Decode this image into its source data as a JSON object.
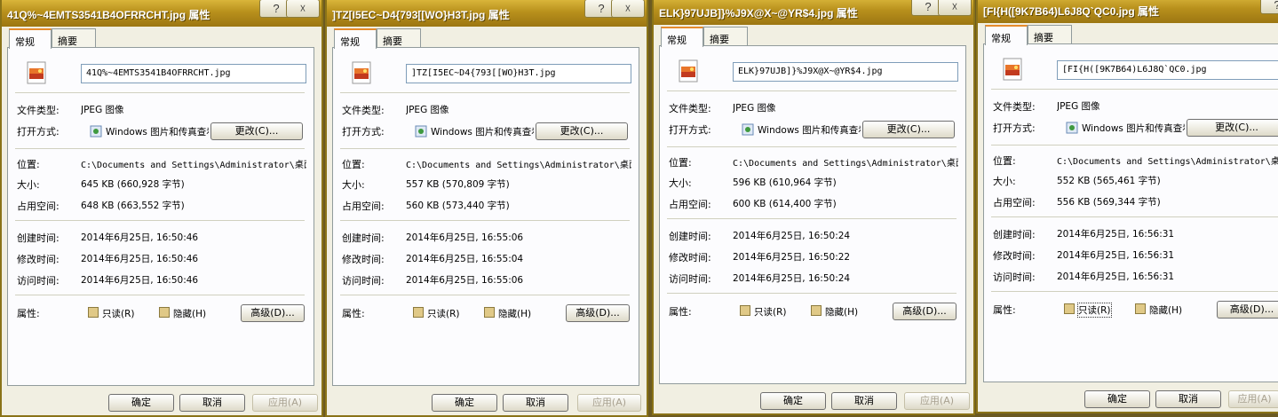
{
  "titlebar_buttons": {
    "help": "?",
    "close": "☓"
  },
  "tabs": {
    "general": "常规",
    "summary": "摘要"
  },
  "labels": {
    "type": "文件类型:",
    "opens_with": "打开方式:",
    "location": "位置:",
    "size": "大小:",
    "size_on_disk": "占用空间:",
    "created": "创建时间:",
    "modified": "修改时间:",
    "accessed": "访问时间:",
    "attributes": "属性:"
  },
  "buttons": {
    "change": "更改(C)...",
    "advanced": "高级(D)...",
    "ok": "确定",
    "cancel": "取消",
    "apply": "应用(A)"
  },
  "attrs": {
    "readonly": "只读(R)",
    "hidden": "隐藏(H)"
  },
  "common": {
    "file_type": "JPEG 图像",
    "opens_with_app": "Windows 图片和传真查看器",
    "location": "C:\\Documents and Settings\\Administrator\\桌面"
  },
  "dialogs": [
    {
      "title": "41Q%~4EMTS3541B4OFRRCHT.jpg 属性",
      "filename": "41Q%~4EMTS3541B4OFRRCHT.jpg",
      "size": "645 KB (660,928 字节)",
      "size_on_disk": "648 KB (663,552 字节)",
      "created": "2014年6月25日, 16:50:46",
      "modified": "2014年6月25日, 16:50:46",
      "accessed": "2014年6月25日, 16:50:46"
    },
    {
      "title": "]TZ[I5EC~D4{793[[WO}H3T.jpg 属性",
      "filename": "]TZ[I5EC~D4{793[[WO}H3T.jpg",
      "size": "557 KB (570,809 字节)",
      "size_on_disk": "560 KB (573,440 字节)",
      "created": "2014年6月25日, 16:55:06",
      "modified": "2014年6月25日, 16:55:04",
      "accessed": "2014年6月25日, 16:55:06"
    },
    {
      "title": "ELK}97UJB]}%J9X@X~@YR$4.jpg 属性",
      "filename": "ELK}97UJB]}%J9X@X~@YR$4.jpg",
      "size": "596 KB (610,964 字节)",
      "size_on_disk": "600 KB (614,400 字节)",
      "created": "2014年6月25日, 16:50:24",
      "modified": "2014年6月25日, 16:50:22",
      "accessed": "2014年6月25日, 16:50:24"
    },
    {
      "title": "[FI{H([9K7B64)L6J8Q`QC0.jpg 属性",
      "filename": "[FI{H([9K7B64)L6J8Q`QC0.jpg",
      "size": "552 KB (565,461 字节)",
      "size_on_disk": "556 KB (569,344 字节)",
      "created": "2014年6月25日, 16:56:31",
      "modified": "2014年6月25日, 16:56:31",
      "accessed": "2014年6月25日, 16:56:31"
    }
  ]
}
